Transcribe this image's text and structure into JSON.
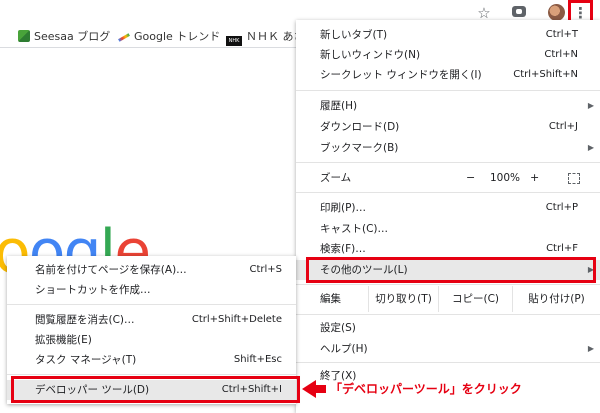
{
  "toolbar": {
    "star_icon": "star-icon",
    "extension_icon": "extension-icon",
    "menu_icon": "⋮"
  },
  "bookmarks": [
    {
      "label": "Seesaa ブログ"
    },
    {
      "label": "Google トレンド"
    },
    {
      "label": "ＮＨＫ あさ"
    }
  ],
  "page": {
    "logo_letters": [
      "o",
      "o",
      "g",
      "l",
      "e"
    ]
  },
  "menu": {
    "new_tab": {
      "label": "新しいタブ(T)",
      "shortcut": "Ctrl+T"
    },
    "new_window": {
      "label": "新しいウィンドウ(N)",
      "shortcut": "Ctrl+N"
    },
    "incognito": {
      "label": "シークレット ウィンドウを開く(I)",
      "shortcut": "Ctrl+Shift+N"
    },
    "history": {
      "label": "履歴(H)"
    },
    "downloads": {
      "label": "ダウンロード(D)",
      "shortcut": "Ctrl+J"
    },
    "bookmarks": {
      "label": "ブックマーク(B)"
    },
    "zoom": {
      "label": "ズーム",
      "minus": "−",
      "value": "100%",
      "plus": "+"
    },
    "print": {
      "label": "印刷(P)…",
      "shortcut": "Ctrl+P"
    },
    "cast": {
      "label": "キャスト(C)…"
    },
    "find": {
      "label": "検索(F)…",
      "shortcut": "Ctrl+F"
    },
    "more_tools": {
      "label": "その他のツール(L)"
    },
    "edit": {
      "label": "編集",
      "cut": "切り取り(T)",
      "copy": "コピー(C)",
      "paste": "貼り付け(P)"
    },
    "settings": {
      "label": "設定(S)"
    },
    "help": {
      "label": "ヘルプ(H)"
    },
    "exit": {
      "label": "終了(X)"
    }
  },
  "submenu": {
    "save_page": {
      "label": "名前を付けてページを保存(A)…",
      "shortcut": "Ctrl+S"
    },
    "create_shortcut": {
      "label": "ショートカットを作成…"
    },
    "clear_history": {
      "label": "閲覧履歴を消去(C)…",
      "shortcut": "Ctrl+Shift+Delete"
    },
    "extensions": {
      "label": "拡張機能(E)"
    },
    "task_manager": {
      "label": "タスク マネージャ(T)",
      "shortcut": "Shift+Esc"
    },
    "dev_tools": {
      "label": "デベロッパー ツール(D)",
      "shortcut": "Ctrl+Shift+I"
    }
  },
  "annotation": {
    "text": "「デベロッパーツール」をクリック",
    "color": "#e60012"
  }
}
